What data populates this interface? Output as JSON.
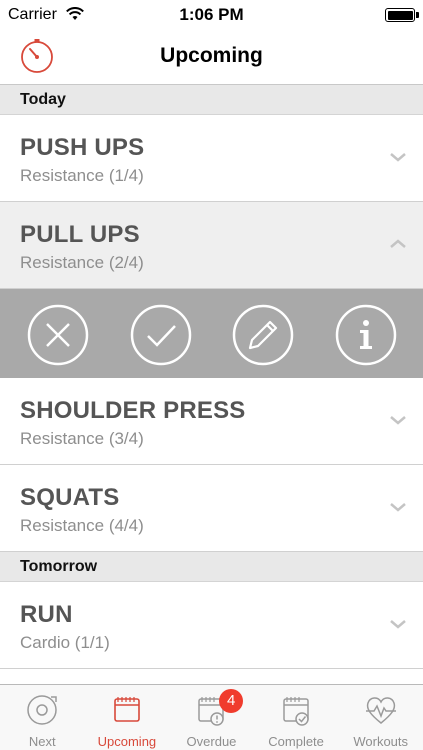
{
  "status_bar": {
    "carrier": "Carrier",
    "time": "1:06 PM"
  },
  "nav": {
    "title": "Upcoming"
  },
  "sections": [
    {
      "header": "Today"
    },
    {
      "header": "Tomorrow"
    }
  ],
  "rows": [
    {
      "title": "PUSH UPS",
      "subtitle": "Resistance (1/4)"
    },
    {
      "title": "PULL UPS",
      "subtitle": "Resistance (2/4)"
    },
    {
      "title": "SHOULDER PRESS",
      "subtitle": "Resistance (3/4)"
    },
    {
      "title": "SQUATS",
      "subtitle": "Resistance (4/4)"
    },
    {
      "title": "RUN",
      "subtitle": "Cardio (1/1)"
    }
  ],
  "tabs": [
    {
      "label": "Next",
      "icon": "next-icon"
    },
    {
      "label": "Upcoming",
      "icon": "calendar-icon"
    },
    {
      "label": "Overdue",
      "icon": "calendar-alert-icon",
      "badge": "4"
    },
    {
      "label": "Complete",
      "icon": "calendar-check-icon"
    },
    {
      "label": "Workouts",
      "icon": "heart-pulse-icon"
    }
  ],
  "colors": {
    "accent": "#d8493a",
    "badge": "#f03c2d",
    "action_bar": "#a9a9a9",
    "title_text": "#555555",
    "subtitle_text": "#8e8e8e",
    "section_bg": "#e8e8e8"
  }
}
